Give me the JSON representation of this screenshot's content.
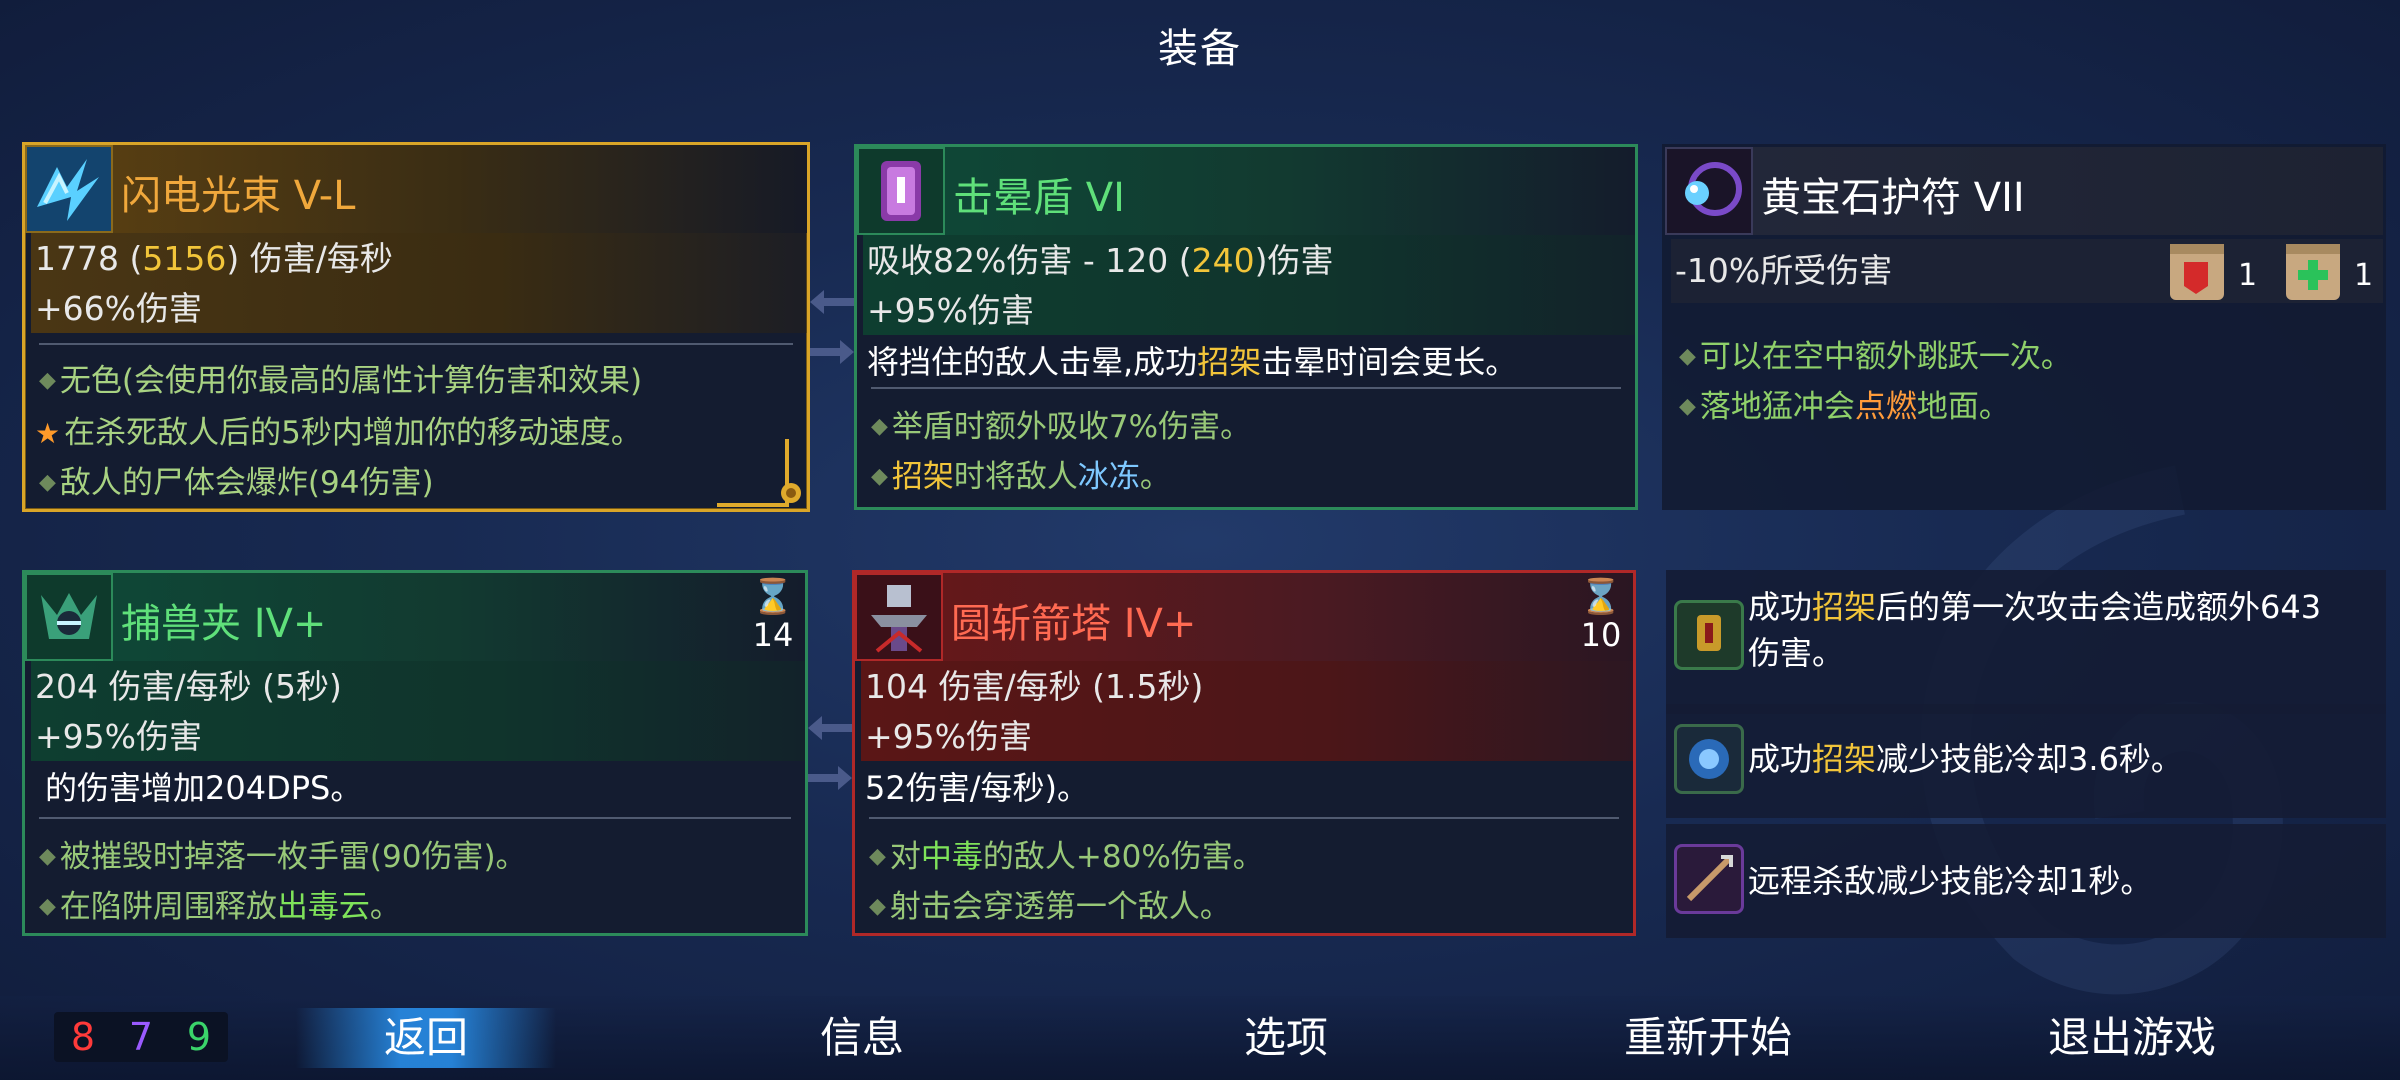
{
  "screen_title": "装备",
  "items": {
    "lightning": {
      "name": "闪电光束 V-L",
      "stat1_pre": "1778 (",
      "stat1_hi": "5156",
      "stat1_post": ") 伤害/每秒",
      "stat2": "+66%伤害",
      "bullets": [
        {
          "text": "无色(会使用你最高的属性计算伤害和效果)"
        },
        {
          "text": "在杀死敌人后的5秒内增加你的移动速度。"
        },
        {
          "text": "敌人的尸体会爆炸(94伤害)"
        }
      ],
      "icon": "lightning-icon",
      "accent": "#d9a528"
    },
    "shield": {
      "name": "击晕盾 VI",
      "stat1_pre": "吸收82%伤害 - 120 (",
      "stat1_hi": "240",
      "stat1_post": ")伤害",
      "stat2": "+95%伤害",
      "desc_pre": "将挡住的敌人击晕,成功",
      "desc_hi": "招架",
      "desc_post": "击晕时间会更长。",
      "bullets": [
        {
          "text": "举盾时额外吸收7%伤害。"
        },
        {
          "pre": "",
          "hi": "招架",
          "mid": "时将敌人",
          "ice": "冰冻",
          "post": "。"
        }
      ],
      "icon": "shield-icon",
      "accent": "#2c8a5a"
    },
    "amulet": {
      "name": "黄宝石护符 VII",
      "stat1": "-10%所受伤害",
      "scroll_counts": [
        "1",
        "1"
      ],
      "bullets": [
        {
          "text": "可以在空中额外跳跃一次。"
        },
        {
          "pre": "落地猛冲会",
          "hi": "点燃",
          "post": "地面。"
        }
      ],
      "icon": "amulet-icon"
    },
    "trap": {
      "name": "捕兽夹 IV+",
      "cooldown": "14",
      "stat1": "204 伤害/每秒 (5秒)",
      "stat2": "+95%伤害",
      "desc": "的伤害增加204DPS。",
      "bullets": [
        {
          "text": "被摧毁时掉落一枚手雷(90伤害)。"
        },
        {
          "pre": "在陷阱周围释放",
          "hi": "出毒云",
          "post": "。"
        }
      ],
      "icon": "wolf-trap-icon",
      "accent": "#2c8a5a"
    },
    "turret": {
      "name": "圆斩箭塔 IV+",
      "cooldown": "10",
      "stat1": "104 伤害/每秒 (1.5秒)",
      "stat2": "+95%伤害",
      "desc": "52伤害/每秒)。",
      "bullets": [
        {
          "pre": "对",
          "hi": "中毒",
          "post": "的敌人+80%伤害。"
        },
        {
          "text": "射击会穿透第一个敌人。"
        }
      ],
      "icon": "turret-icon",
      "accent": "#b02828"
    }
  },
  "mutations": [
    {
      "pre": "成功",
      "hi": "招架",
      "post": "后的第一次攻击会造成额外643",
      "line2": "伤害。",
      "icon": "parry-mutation-icon"
    },
    {
      "pre": "成功",
      "hi": "招架",
      "post": "减少技能冷却3.6秒。",
      "line2": "",
      "icon": "parry-cooldown-icon"
    },
    {
      "pre": "远程杀敌减少技能冷却1秒。",
      "hi": "",
      "post": "",
      "line2": "",
      "icon": "ranged-kill-icon"
    }
  ],
  "stats_counter": {
    "brutality": "8",
    "tactics": "7",
    "survival": "9",
    "colors": {
      "brutality": "#ff3a3a",
      "tactics": "#9a5aff",
      "survival": "#3ad46a"
    }
  },
  "menu": {
    "back": "返回",
    "info": "信息",
    "options": "选项",
    "restart": "重新开始",
    "quit": "退出游戏"
  }
}
